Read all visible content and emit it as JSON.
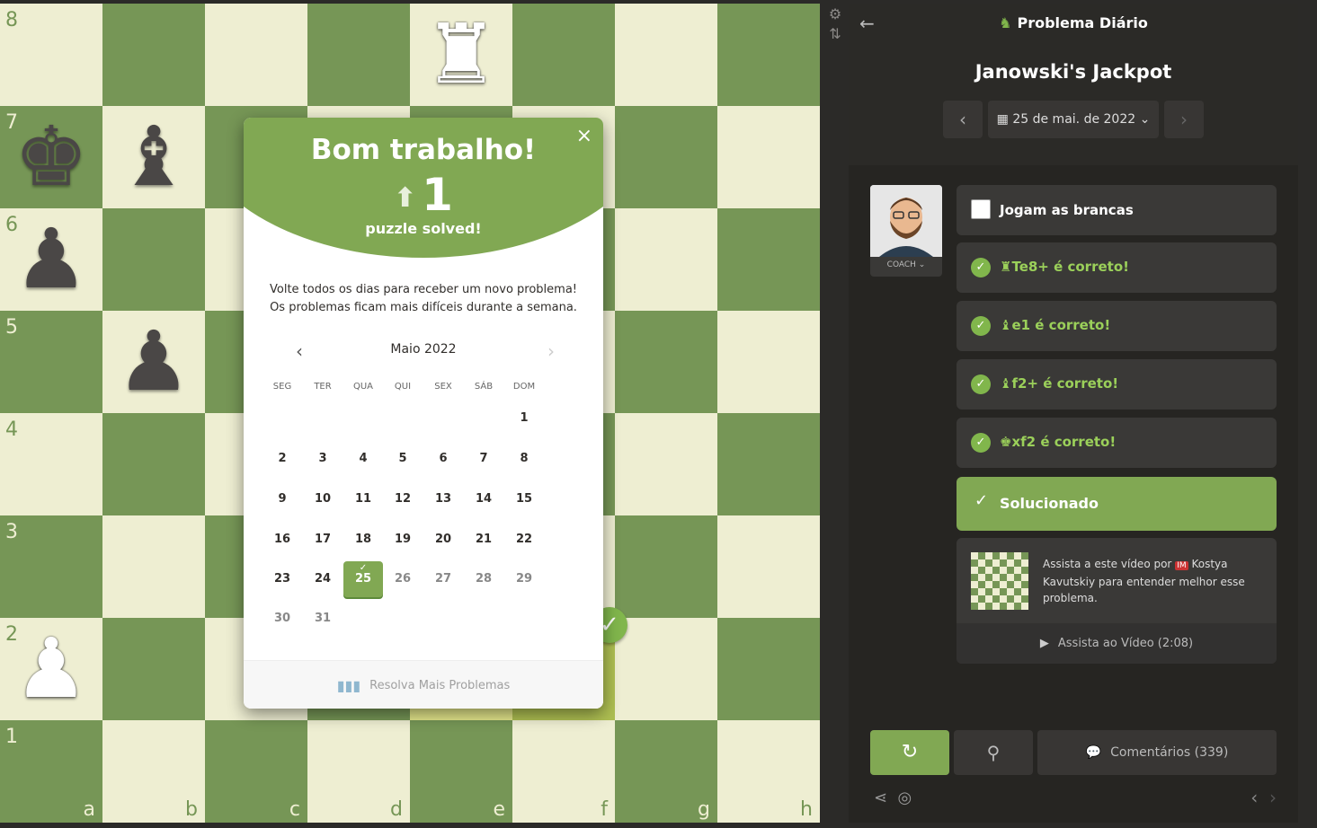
{
  "board": {
    "ranks": [
      "8",
      "7",
      "6",
      "5",
      "4",
      "3",
      "2",
      "1"
    ],
    "files": [
      "a",
      "b",
      "c",
      "d",
      "e",
      "f",
      "g",
      "h"
    ],
    "pieces": [
      {
        "square": "e8",
        "glyph": "♜",
        "color": "white",
        "name": "white-rook"
      },
      {
        "square": "a7",
        "glyph": "♚",
        "color": "black",
        "name": "black-king"
      },
      {
        "square": "b7",
        "glyph": "♝",
        "color": "black",
        "name": "black-bishop"
      },
      {
        "square": "a6",
        "glyph": "♟",
        "color": "black",
        "name": "black-pawn"
      },
      {
        "square": "b5",
        "glyph": "♟",
        "color": "black",
        "name": "black-pawn"
      },
      {
        "square": "a2",
        "glyph": "♟",
        "color": "white",
        "name": "white-pawn"
      }
    ],
    "tool_icons": [
      "⚙",
      "⇅"
    ],
    "check_glyph": "✓"
  },
  "modal": {
    "title": "Bom trabalho!",
    "close": "×",
    "arrow": "⬆",
    "score": "1",
    "solved_label": "puzzle solved!",
    "message_line1": "Volte todos os dias para receber um novo problema!",
    "message_line2": "Os problemas ficam mais difíceis durante a semana.",
    "calendar": {
      "month": "Maio 2022",
      "prev": "‹",
      "next": "›",
      "weekdays": [
        "SEG",
        "TER",
        "QUA",
        "QUI",
        "SEX",
        "SÁB",
        "DOM"
      ],
      "weeks": [
        [
          "",
          "",
          "",
          "",
          "",
          "",
          "1"
        ],
        [
          "2",
          "3",
          "4",
          "5",
          "6",
          "7",
          "8"
        ],
        [
          "9",
          "10",
          "11",
          "12",
          "13",
          "14",
          "15"
        ],
        [
          "16",
          "17",
          "18",
          "19",
          "20",
          "21",
          "22"
        ],
        [
          "23",
          "24",
          "25",
          "26",
          "27",
          "28",
          "29"
        ],
        [
          "30",
          "31",
          "",
          "",
          "",
          "",
          ""
        ]
      ],
      "today": "25",
      "last_past_day": 25
    },
    "footer": "Resolva Mais Problemas"
  },
  "panel": {
    "title": "Problema Diário",
    "puzzle_name": "Janowski's Jackpot",
    "date": "25 de mai. de 2022",
    "coach_label": "COACH",
    "turn": "Jogam as brancas",
    "moves": [
      {
        "icon": "♜",
        "text": "Te8+ é correto!"
      },
      {
        "icon": "♝",
        "text": "e1 é correto!"
      },
      {
        "icon": "♝",
        "text": "f2+ é correto!"
      },
      {
        "icon": "♚",
        "text": "xf2 é correto!"
      }
    ],
    "solved": "Solucionado",
    "video_text_1": "Assista a este vídeo por",
    "video_badge": "IM",
    "video_text_2": "Kostya Kavutskiy para entender melhor esse problema.",
    "video_link": "Assista ao Vídeo (2:08)",
    "comments": "Comentários",
    "comments_count": "(339)"
  },
  "colors": {
    "light": "#eeeed2",
    "dark": "#769656",
    "accent": "#81a853"
  }
}
